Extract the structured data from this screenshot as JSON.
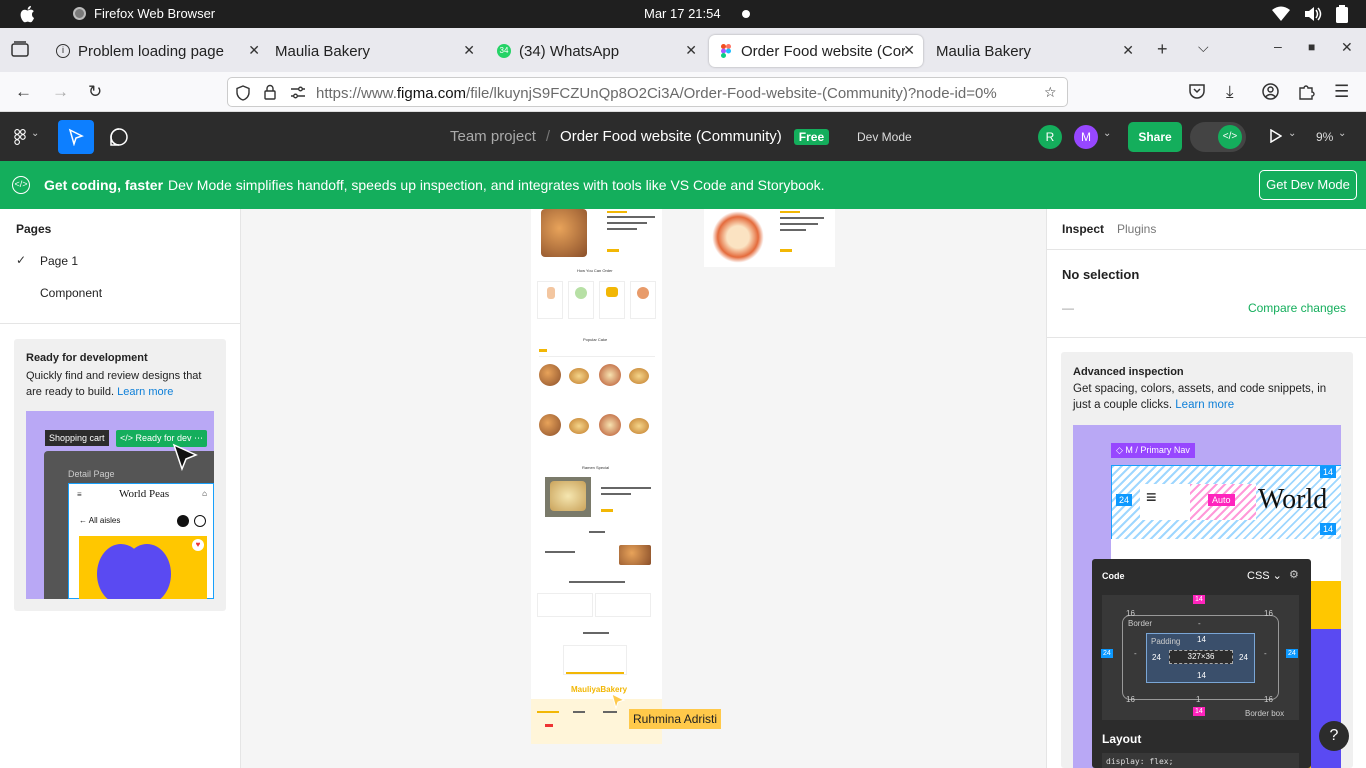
{
  "os": {
    "app_name": "Firefox Web Browser",
    "clock": "Mar 17  21:54"
  },
  "tabs": [
    {
      "label": "Problem loading page",
      "icon": "info-icon"
    },
    {
      "label": "Maulia Bakery",
      "icon": "none"
    },
    {
      "label": "(34) WhatsApp",
      "icon": "whatsapp-icon",
      "badge": "34"
    },
    {
      "label": "Order Food website (Cor",
      "icon": "figma-icon",
      "active": true
    },
    {
      "label": "Maulia Bakery",
      "icon": "none"
    }
  ],
  "url": {
    "prefix": "https://www.",
    "domain": "figma.com",
    "path": "/file/lkuynjS9FCZUnQp8O2Ci3A/Order-Food-website-(Community)?node-id=0%"
  },
  "figma": {
    "team": "Team project",
    "separator": "/",
    "file_name": "Order Food website (Community)",
    "free_badge": "Free",
    "dev_mode_label": "Dev Mode",
    "avatar_r": "R",
    "avatar_m": "M",
    "share": "Share",
    "zoom": "9%"
  },
  "banner": {
    "title": "Get coding, faster",
    "text": "Dev Mode simplifies handoff, speeds up inspection, and integrates with tools like VS Code and Storybook.",
    "button": "Get Dev Mode"
  },
  "left_panel": {
    "pages_title": "Pages",
    "pages": [
      "Page 1",
      "Component"
    ],
    "promo": {
      "title": "Ready for development",
      "text": "Quickly find and review designs that are ready to build.",
      "link": "Learn more",
      "chip_cart": "Shopping cart",
      "chip_ready": "Ready for dev",
      "detail_page": "Detail Page",
      "world_peas": "World Peas",
      "all_aisles": "All aisles"
    }
  },
  "canvas": {
    "cursor_user": "Ruhmina Adristi",
    "frame_texts": {
      "how_order": "How You Can Order",
      "popular": "Popular Cake",
      "ramen": "Ramen Special",
      "footer_brand": "MauliyaBakery"
    }
  },
  "right_panel": {
    "tabs": [
      "Inspect",
      "Plugins"
    ],
    "no_selection": "No selection",
    "dash": "—",
    "compare": "Compare changes",
    "advanced": {
      "title": "Advanced inspection",
      "text": "Get spacing, colors, assets, and code snippets, in just a couple clicks.",
      "link": "Learn more",
      "nav_tag": "M / Primary Nav",
      "auto": "Auto",
      "world": "World",
      "code_title": "Code",
      "code_lang": "CSS",
      "border_label": "Border",
      "padding_label": "Padding",
      "size": "327×36",
      "border_box": "Border box",
      "layout": "Layout",
      "code_line": "display: flex;",
      "n14": "14",
      "n16": "16",
      "n24": "24",
      "n1": "1",
      "dash": "-"
    }
  },
  "help": "?"
}
